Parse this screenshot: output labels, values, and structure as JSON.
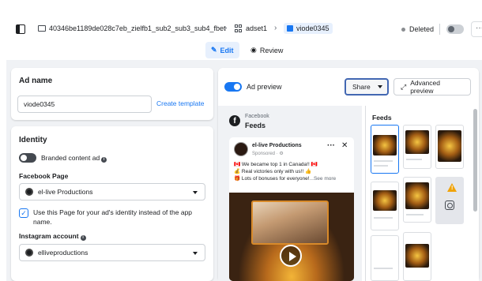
{
  "topbar": {
    "campaign": "40346be1189de028c7eb_zielfb1_sub2_sub3_sub4_fbet",
    "adset": "adset1",
    "ad": "viode0345",
    "status": "Deleted",
    "more": "···"
  },
  "tabs": {
    "edit": "Edit",
    "review": "Review"
  },
  "adname": {
    "title": "Ad name",
    "value": "viode0345",
    "create_template": "Create template"
  },
  "identity": {
    "title": "Identity",
    "branded_content": "Branded content ad",
    "facebook_page_label": "Facebook Page",
    "facebook_page_value": "el-live Productions",
    "use_page_text": "Use this Page for your ad's identity instead of the app name.",
    "instagram_label": "Instagram account",
    "instagram_value": "elliveproductions"
  },
  "preview": {
    "toggle_label": "Ad preview",
    "share": "Share",
    "advanced": "Advanced preview",
    "platform": "Facebook",
    "placement": "Feeds",
    "right_title": "Feeds",
    "post": {
      "name": "el-live Productions",
      "sponsored": "Sponsored · ⚙",
      "line1": "🇨🇦 We became top 1 in Canada!! 🇨🇦",
      "line2": "💰 Real victories only with us!! 👍",
      "line3": "🎁 Lots of bonuses for everyone!",
      "see_more": "...See more"
    }
  },
  "colors": {
    "accent": "#1877f2",
    "warning": "#f0a30a"
  }
}
